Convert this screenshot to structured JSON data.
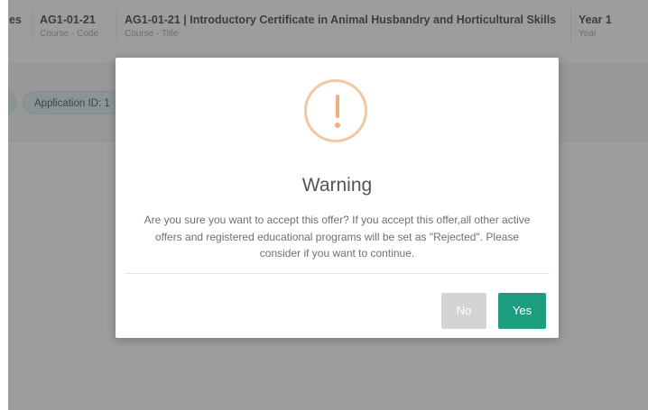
{
  "background": {
    "header": [
      {
        "value": "es",
        "label": ""
      },
      {
        "value": "AG1-01-21",
        "label": "Course - Code"
      },
      {
        "value": "AG1-01-21 | Introductory Certificate in Animal Husbandry and Horticultural Skills",
        "label": "Course - Title"
      },
      {
        "value": "Year 1",
        "label": "Year"
      }
    ],
    "application_pill": "Application ID: 1"
  },
  "modal": {
    "title": "Warning",
    "message": "Are you sure you want to accept this offer? If you accept this offer,all other active offers and registered educational programs will be set as \"Rejected\". Please consider if you want to continue.",
    "icon": "warning-exclamation-icon",
    "no_label": "No",
    "yes_label": "Yes"
  },
  "colors": {
    "overlay": "#7f7f7f",
    "warning_accent": "#f2b07a",
    "yes_button": "#1e9e80",
    "no_button": "#d4d4d4"
  }
}
